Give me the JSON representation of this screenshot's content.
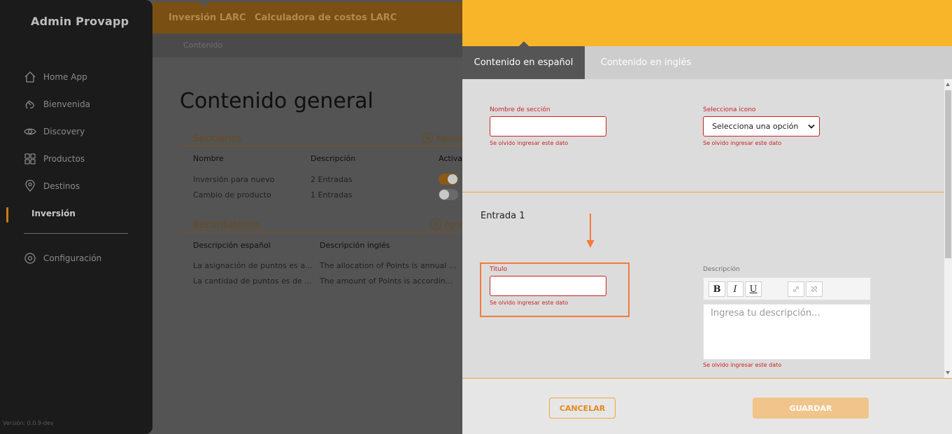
{
  "sidebar": {
    "brand": "Admin Provapp",
    "items": [
      {
        "label": "Home App",
        "icon": "home-icon"
      },
      {
        "label": "Bienvenida",
        "icon": "hand-wave-icon"
      },
      {
        "label": "Discovery",
        "icon": "eye-icon"
      },
      {
        "label": "Productos",
        "icon": "grid-icon"
      },
      {
        "label": "Destinos",
        "icon": "location-pin-icon"
      },
      {
        "label": "Inversión",
        "icon": ""
      },
      {
        "label": "Configuración",
        "icon": "gear-icon"
      }
    ],
    "version": "Versión: 0.0.9-dev"
  },
  "topbar": {
    "tabs": [
      "Inversión LARC",
      "Calculadora de costos LARC"
    ],
    "breadcrumb": "Contenido"
  },
  "main": {
    "title": "Contenido general",
    "secciones": {
      "label": "Secciones",
      "add_label": "Agrega",
      "headers": [
        "Nombre",
        "Descripción",
        "Activar"
      ],
      "rows": [
        {
          "nombre": "Inversión para nuevo",
          "descripcion": "2 Entradas",
          "active": true
        },
        {
          "nombre": "Cambio de producto",
          "descripcion": "1 Entradas",
          "active": false
        }
      ]
    },
    "recordatorios": {
      "label": "Recordatorios",
      "add_label": "Agreg",
      "headers": [
        "Descripción español",
        "Descripción inglés"
      ],
      "rows": [
        {
          "es": "La asignación de puntos es a...",
          "en": "The allocation of Points is annual ..."
        },
        {
          "es": "La cantidad de puntos es de ...",
          "en": "The amount of Points is accordin..."
        }
      ]
    }
  },
  "panel": {
    "tabs": [
      "Contenido en español",
      "Contenido en inglés"
    ],
    "nombre_label": "Nombre de sección",
    "icono_label": "Selecciona icono",
    "icono_selected": "Selecciona una opción",
    "error_text": "Se olvido ingresar este dato",
    "entry_title": "Entrada 1",
    "titulo_label": "Titulo",
    "descripcion_label": "Descripción",
    "descripcion_placeholder": "Ingresa tu descripción...",
    "toolbar": {
      "bold": "B",
      "italic": "I",
      "underline": "U"
    },
    "cancel_label": "CANCELAR",
    "save_label": "GUARDAR"
  },
  "colors": {
    "header_yellow": "#f9b52a",
    "error_red": "#cc2222",
    "highlight_orange": "#f47a3c",
    "save_button": "#f0c48a"
  }
}
